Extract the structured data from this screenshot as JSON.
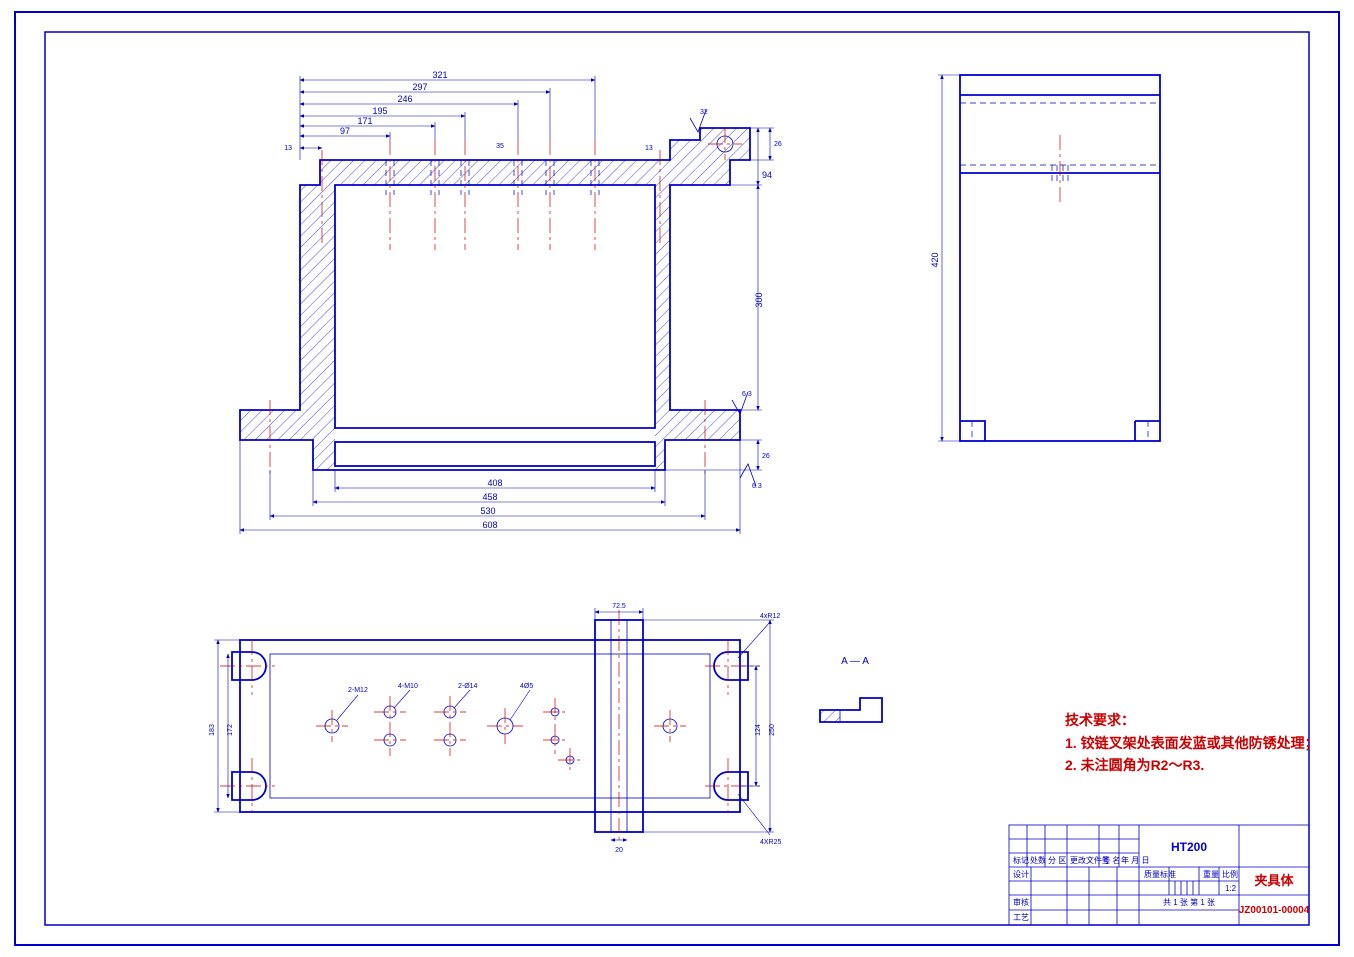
{
  "drawing": {
    "front_view": {
      "top_dims": {
        "d321": "321",
        "d297": "297",
        "d246": "246",
        "d195": "195",
        "d171": "171",
        "d97": "97",
        "d13": "13",
        "d13r": "13",
        "d35": "35"
      },
      "right_dims": {
        "d26t": "26",
        "d94": "94",
        "d300": "300",
        "d26b": "26"
      },
      "bottom_dims": {
        "d408": "408",
        "d458": "458",
        "d530": "530",
        "d608": "608"
      },
      "surf": {
        "t32": "32",
        "t63": "6.3",
        "t63b": "6.3"
      }
    },
    "side_view": {
      "dim420": "420"
    },
    "top_view": {
      "dims": {
        "d725": "72.5",
        "d20": "20",
        "d183": "183",
        "d172": "172",
        "d124": "124",
        "d250": "250"
      },
      "callouts": {
        "c2m12": "2-M12",
        "c4m10": "4-M10",
        "c2d14": "2-Ø14",
        "c4d5": "4Ø5",
        "c4r12": "4xR12",
        "c4r25": "4XR25"
      }
    },
    "section": {
      "label": "A — A"
    },
    "tech_req": {
      "title": "技术要求：",
      "line1": "1. 铰链叉架处表面发蓝或其他防锈处理；",
      "line2": "2. 未注圆角为R2～R3."
    },
    "title_block": {
      "material": "HT200",
      "part_name": "夹具体",
      "drawing_no": "JZ00101-00004",
      "scale": "1:2",
      "sheet": "共 1 张    第 1 张",
      "headers": {
        "h1": "标记",
        "h2": "处数",
        "h3": "分 区",
        "h4": "更改文件号",
        "h5": "签 名",
        "h6": "年 月 日",
        "r1": "设计",
        "r2": "审核",
        "r3": "工艺",
        "c1": "质量标准",
        "c2": "重量",
        "c3": "比例"
      }
    }
  }
}
